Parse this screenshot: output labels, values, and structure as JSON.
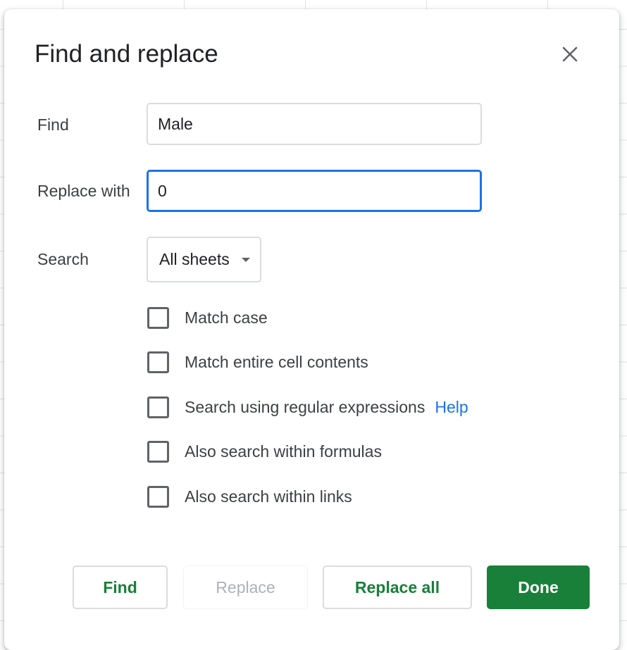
{
  "dialog": {
    "title": "Find and replace"
  },
  "find": {
    "label": "Find",
    "value": "Male"
  },
  "replace": {
    "label": "Replace with",
    "value": "0"
  },
  "search": {
    "label": "Search",
    "selected": "All sheets"
  },
  "options": [
    {
      "label": "Match case",
      "checked": false
    },
    {
      "label": "Match entire cell contents",
      "checked": false
    },
    {
      "label": "Search using regular expressions",
      "checked": false
    },
    {
      "label": "Also search within formulas",
      "checked": false
    },
    {
      "label": "Also search within links",
      "checked": false
    }
  ],
  "help_link": "Help",
  "buttons": {
    "find": "Find",
    "replace": "Replace",
    "replace_all": "Replace all",
    "done": "Done"
  },
  "icons": {
    "close": "close-icon",
    "dropdown": "chevron-down-icon"
  },
  "colors": {
    "accent_green": "#188038",
    "focus_blue": "#1a73e8",
    "link_blue": "#1a73e8"
  }
}
